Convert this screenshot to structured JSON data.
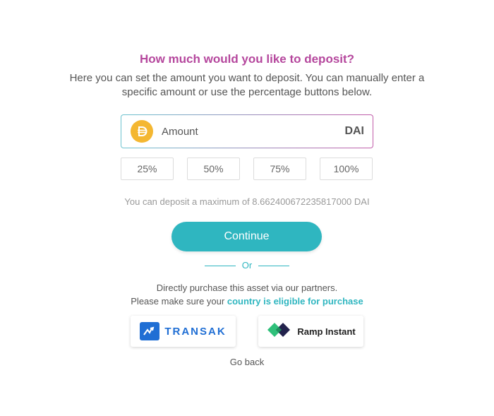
{
  "header": {
    "title": "How much would you like to deposit?",
    "subtitle": "Here you can set the amount you want to deposit. You can manually enter a specific amount or use the percentage buttons below."
  },
  "amount_input": {
    "placeholder": "Amount",
    "currency": "DAI",
    "coin_icon": "dai-coin-icon",
    "coin_color": "#f4b731"
  },
  "percentage_buttons": [
    "25%",
    "50%",
    "75%",
    "100%"
  ],
  "max_note": "You can deposit a maximum of 8.662400672235817000 DAI",
  "continue_label": "Continue",
  "or_label": "Or",
  "partners": {
    "line1": "Directly purchase this asset via our partners.",
    "line2_prefix": "Please make sure your ",
    "line2_link": "country is eligible for purchase",
    "transak_label": "TRANSAK",
    "ramp_label": "Ramp Instant"
  },
  "go_back_label": "Go back",
  "colors": {
    "title": "#b5479d",
    "accent": "#2fb6c0",
    "transak": "#1f6ed4"
  }
}
